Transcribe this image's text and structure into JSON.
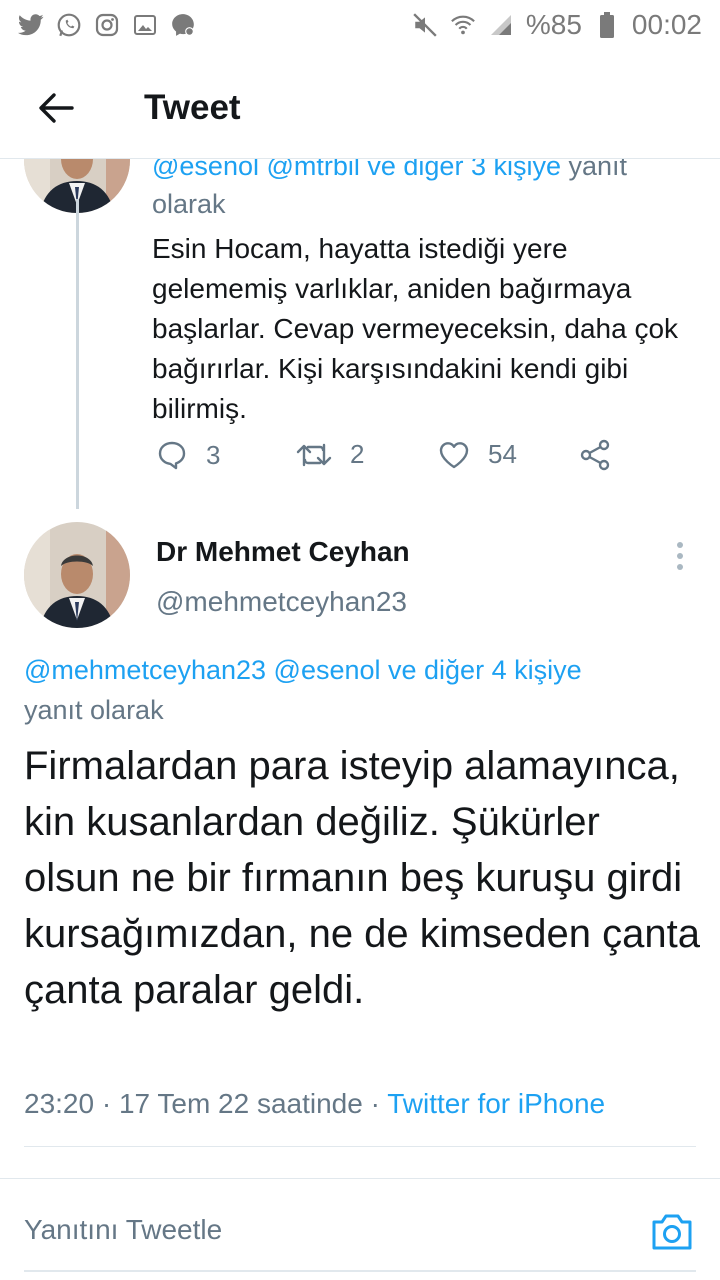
{
  "status_bar": {
    "icons_left": [
      "twitter-icon",
      "whatsapp-icon",
      "instagram-icon",
      "gallery-icon",
      "messenger-icon"
    ],
    "icons_right": [
      "mute-icon",
      "wifi-icon",
      "signal-icon",
      "battery-icon"
    ],
    "battery": "%85",
    "time": "00:02"
  },
  "app_bar": {
    "title": "Tweet"
  },
  "previous_tweet": {
    "reply_to_handles": "@esenol @mtrbil ve diğer 3 kişiye",
    "reply_to_suffix": "yanıt olarak",
    "text": "Esin Hocam, hayatta istediği yere gelememiş varlıklar, aniden bağırmaya başlarlar. Cevap vermeyeceksin, daha çok bağırırlar. Kişi karşısındakini kendi gibi bilirmiş.",
    "replies": "3",
    "retweets": "2",
    "likes": "54"
  },
  "main_tweet": {
    "author_name": "Dr Mehmet Ceyhan",
    "author_handle": "@mehmetceyhan23",
    "reply_to_handles": "@mehmetceyhan23 @esenol ve diğer 4 kişiye",
    "reply_to_suffix": "yanıt olarak",
    "text": "Firmalardan para isteyip alamayınca, kin kusanlardan değiliz. Şükürler olsun ne bir fırmanın beş kuruşu girdi kursağımızdan, ne de kimseden çanta çanta paralar geldi.",
    "timestamp": "23:20 · 17 Tem 22 saatinde · ",
    "source": "Twitter for iPhone"
  },
  "compose": {
    "placeholder": "Yanıtını Tweetle"
  },
  "colors": {
    "accent": "#1da1f2",
    "text_primary": "#14171a",
    "text_secondary": "#657786",
    "divider": "#e1e8ed"
  }
}
